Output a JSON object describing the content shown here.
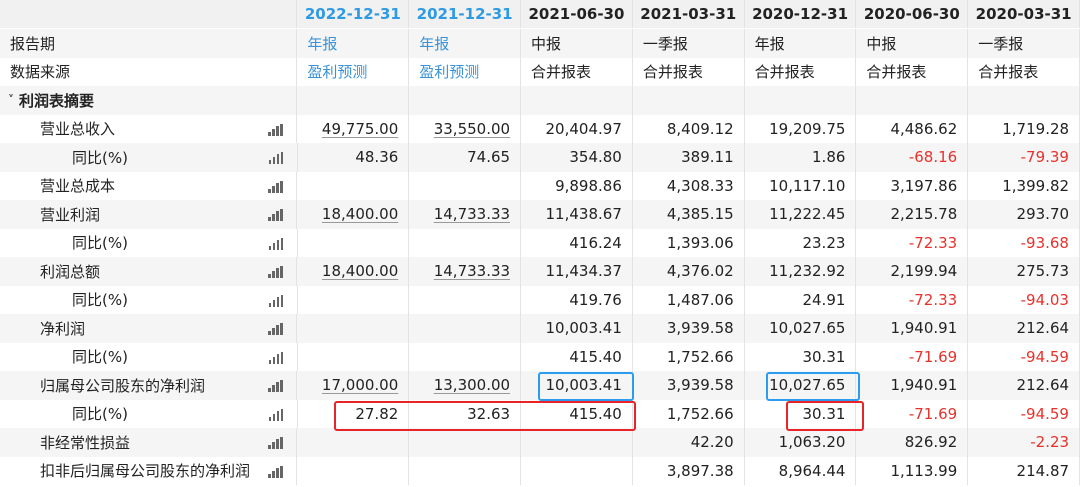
{
  "columns": [
    {
      "date": "2022-12-31",
      "type": "年报",
      "source": "盈利预测",
      "highlight": true
    },
    {
      "date": "2021-12-31",
      "type": "年报",
      "source": "盈利预测",
      "highlight": true
    },
    {
      "date": "2021-06-30",
      "type": "中报",
      "source": "合并报表",
      "highlight": false
    },
    {
      "date": "2021-03-31",
      "type": "一季报",
      "source": "合并报表",
      "highlight": false
    },
    {
      "date": "2020-12-31",
      "type": "年报",
      "source": "合并报表",
      "highlight": false
    },
    {
      "date": "2020-06-30",
      "type": "中报",
      "source": "合并报表",
      "highlight": false
    },
    {
      "date": "2020-03-31",
      "type": "一季报",
      "source": "合并报表",
      "highlight": false
    }
  ],
  "meta_labels": {
    "report_period": "报告期",
    "data_source": "数据来源"
  },
  "section": {
    "label": "利润表摘要",
    "collapse_icon": "chevron-down-icon"
  },
  "rows": [
    {
      "label": "营业总收入",
      "level": 1,
      "values": [
        "49,775.00",
        "33,550.00",
        "20,404.97",
        "8,409.12",
        "19,209.75",
        "4,486.62",
        "1,719.28"
      ]
    },
    {
      "label": "同比(%)",
      "level": 2,
      "values": [
        "48.36",
        "74.65",
        "354.80",
        "389.11",
        "1.86",
        "-68.16",
        "-79.39"
      ]
    },
    {
      "label": "营业总成本",
      "level": 1,
      "values": [
        "",
        "",
        "9,898.86",
        "4,308.33",
        "10,117.10",
        "3,197.86",
        "1,399.82"
      ]
    },
    {
      "label": "营业利润",
      "level": 1,
      "values": [
        "18,400.00",
        "14,733.33",
        "11,438.67",
        "4,385.15",
        "11,222.45",
        "2,215.78",
        "293.70"
      ]
    },
    {
      "label": "同比(%)",
      "level": 2,
      "values": [
        "",
        "",
        "416.24",
        "1,393.06",
        "23.23",
        "-72.33",
        "-93.68"
      ]
    },
    {
      "label": "利润总额",
      "level": 1,
      "values": [
        "18,400.00",
        "14,733.33",
        "11,434.37",
        "4,376.02",
        "11,232.92",
        "2,199.94",
        "275.73"
      ]
    },
    {
      "label": "同比(%)",
      "level": 2,
      "values": [
        "",
        "",
        "419.76",
        "1,487.06",
        "24.91",
        "-72.33",
        "-94.03"
      ]
    },
    {
      "label": "净利润",
      "level": 1,
      "values": [
        "",
        "",
        "10,003.41",
        "3,939.58",
        "10,027.65",
        "1,940.91",
        "212.64"
      ]
    },
    {
      "label": "同比(%)",
      "level": 2,
      "values": [
        "",
        "",
        "415.40",
        "1,752.66",
        "30.31",
        "-71.69",
        "-94.59"
      ]
    },
    {
      "label": "归属母公司股东的净利润",
      "level": 1,
      "values": [
        "17,000.00",
        "13,300.00",
        "10,003.41",
        "3,939.58",
        "10,027.65",
        "1,940.91",
        "212.64"
      ]
    },
    {
      "label": "同比(%)",
      "level": 2,
      "values": [
        "27.82",
        "32.63",
        "415.40",
        "1,752.66",
        "30.31",
        "-71.69",
        "-94.59"
      ]
    },
    {
      "label": "非经常性损益",
      "level": 1,
      "values": [
        "",
        "",
        "",
        "42.20",
        "1,063.20",
        "826.92",
        "-2.23"
      ]
    },
    {
      "label": "扣非后归属母公司股东的净利润",
      "level": 1,
      "values": [
        "",
        "",
        "",
        "3,897.38",
        "8,964.44",
        "1,113.99",
        "214.87"
      ]
    }
  ],
  "colors": {
    "header_highlight": "#2e9ae3",
    "negative": "#e8312b",
    "red_box": "#e8232a",
    "blue_box": "#2b9cf0",
    "forecast_text": "#3a93d8"
  },
  "row_icon": "bar-chart-icon"
}
